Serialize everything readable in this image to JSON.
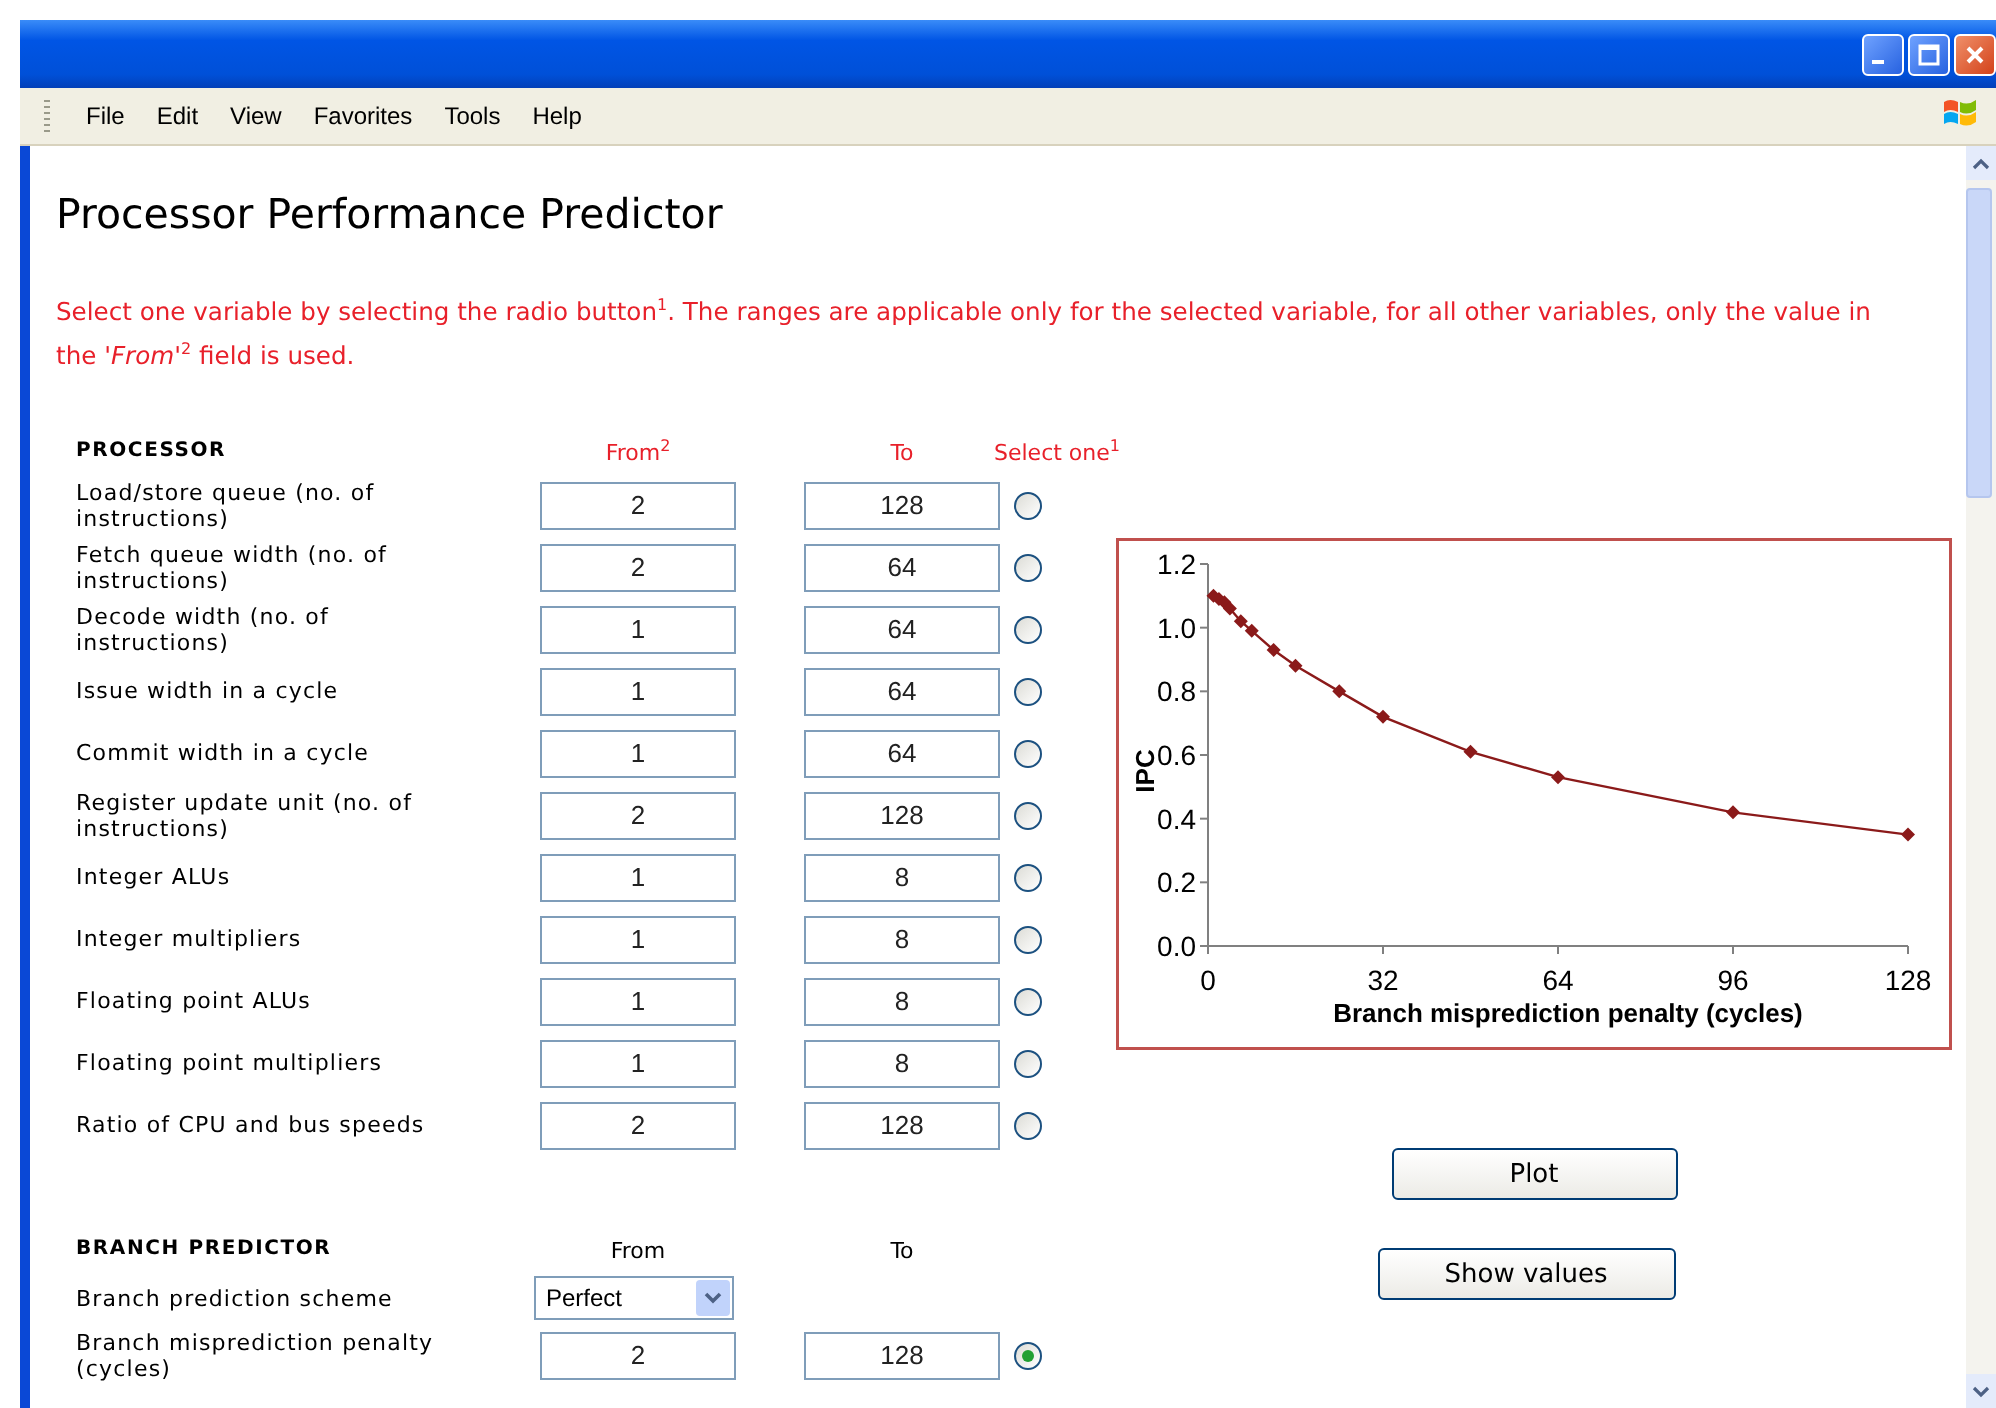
{
  "menu": [
    "File",
    "Edit",
    "View",
    "Favorites",
    "Tools",
    "Help"
  ],
  "page": {
    "title": "Processor Performance Predictor",
    "intro": "Select one variable by selecting the radio button$^{1}$. The ranges are applicable only for the selected variable, for all other variables, only the value in the '*From*'$^{2}$ field is used."
  },
  "processor": {
    "heading": "PROCESSOR",
    "from_label": "From$^{2}$",
    "to_label": "To",
    "select_label": "Select one$^{1}$",
    "rows": [
      {
        "kind": "range",
        "label": "Load/store queue (no. of instructions)",
        "from": "2",
        "to": "128",
        "selected": false
      },
      {
        "kind": "range",
        "label": "Fetch queue width (no. of instructions)",
        "from": "2",
        "to": "64",
        "selected": false
      },
      {
        "kind": "range",
        "label": "Decode width (no. of instructions)",
        "from": "1",
        "to": "64",
        "selected": false
      },
      {
        "kind": "range",
        "label": "Issue width in a cycle",
        "from": "1",
        "to": "64",
        "selected": false
      },
      {
        "kind": "range",
        "label": "Commit width in a cycle",
        "from": "1",
        "to": "64",
        "selected": false
      },
      {
        "kind": "range",
        "label": "Register update unit (no. of instructions)",
        "from": "2",
        "to": "128",
        "selected": false
      },
      {
        "kind": "range",
        "label": "Integer ALUs",
        "from": "1",
        "to": "8",
        "selected": false
      },
      {
        "kind": "range",
        "label": "Integer multipliers",
        "from": "1",
        "to": "8",
        "selected": false
      },
      {
        "kind": "range",
        "label": "Floating point ALUs",
        "from": "1",
        "to": "8",
        "selected": false
      },
      {
        "kind": "range",
        "label": "Floating point multipliers",
        "from": "1",
        "to": "8",
        "selected": false
      },
      {
        "kind": "range",
        "label": "Ratio of CPU and bus speeds",
        "from": "2",
        "to": "128",
        "selected": false
      }
    ]
  },
  "branch_predictor": {
    "heading": "BRANCH PREDICTOR",
    "from_label": "From",
    "to_label": "To",
    "rows": [
      {
        "kind": "select",
        "label": "Branch prediction scheme",
        "value": "Perfect"
      },
      {
        "kind": "range",
        "label": "Branch misprediction penalty (cycles)",
        "from": "2",
        "to": "128",
        "selected": true
      }
    ]
  },
  "chart": {
    "chart_data": {
      "type": "line",
      "xlabel": "Branch misprediction penalty (cycles)",
      "ylabel": "IPC",
      "xlim": [
        0,
        128
      ],
      "ylim": [
        0,
        1.2
      ],
      "x": [
        1,
        2,
        3,
        4,
        6,
        8,
        12,
        16,
        24,
        32,
        48,
        64,
        96,
        128
      ],
      "series": [
        {
          "color": "#8b1a1a",
          "marker": "diamond",
          "values": [
            1.1,
            1.09,
            1.08,
            1.06,
            1.02,
            0.99,
            0.93,
            0.88,
            0.8,
            0.72,
            0.61,
            0.53,
            0.42,
            0.35
          ]
        }
      ],
      "xticks": [
        0,
        32,
        64,
        96,
        128
      ],
      "yticks": [
        {
          "value": 0,
          "label": "0.0"
        },
        {
          "value": 0.2,
          "label": "0.2"
        },
        {
          "value": 0.4,
          "label": "0.4"
        },
        {
          "value": 0.6,
          "label": "0.6"
        },
        {
          "value": 0.8,
          "label": "0.8"
        },
        {
          "value": 1,
          "label": "1.0"
        },
        {
          "value": 1.2,
          "label": "1.2"
        }
      ]
    }
  },
  "buttons": [
    "Plot",
    "Show values"
  ]
}
